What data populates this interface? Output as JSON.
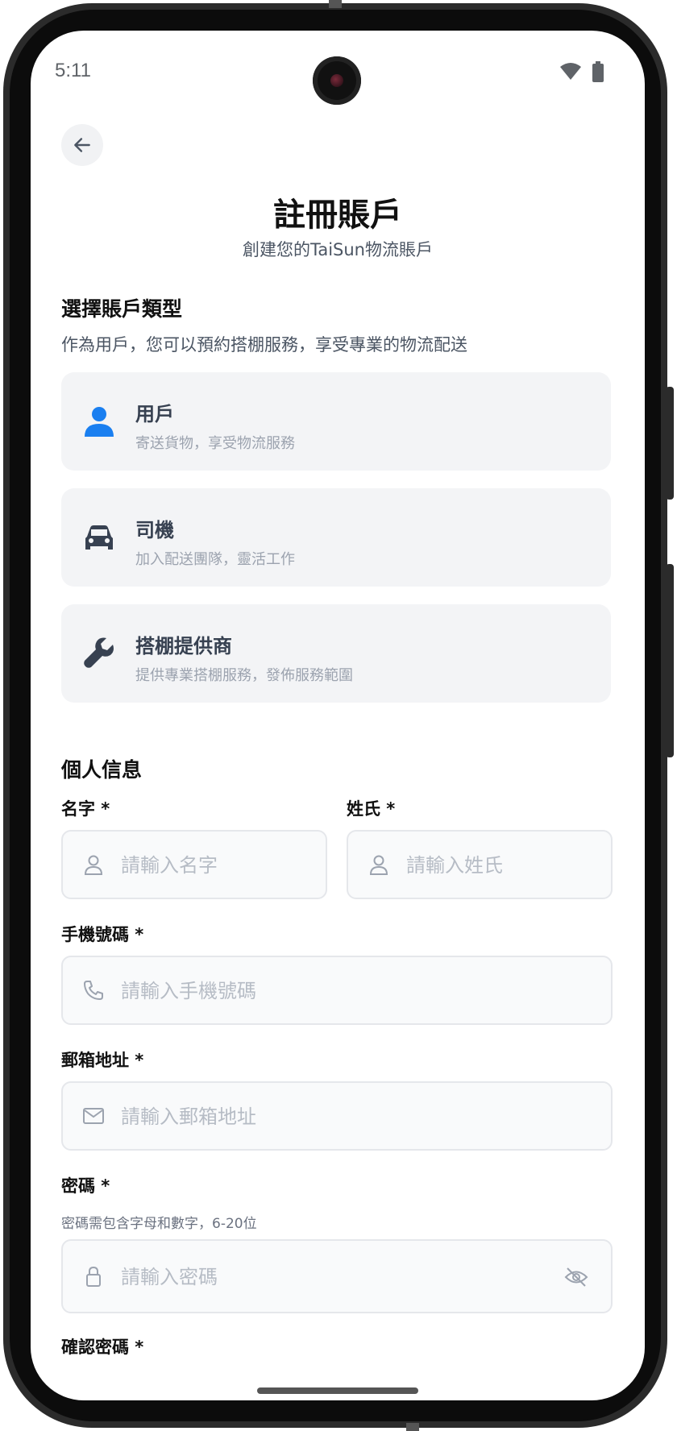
{
  "status_bar": {
    "time": "5:11"
  },
  "header": {
    "title": "註冊賬戶",
    "subtitle": "創建您的TaiSun物流賬戶"
  },
  "account_type": {
    "section_title": "選擇賬戶類型",
    "description": "作為用戶，您可以預約搭棚服務，享受專業的物流配送",
    "options": [
      {
        "label": "用戶",
        "description": "寄送貨物，享受物流服務",
        "icon": "person-icon",
        "selected": true
      },
      {
        "label": "司機",
        "description": "加入配送團隊，靈活工作",
        "icon": "car-icon",
        "selected": false
      },
      {
        "label": "搭棚提供商",
        "description": "提供專業搭棚服務，發佈服務範圍",
        "icon": "wrench-icon",
        "selected": false
      }
    ]
  },
  "personal_info": {
    "section_title": "個人信息",
    "first_name": {
      "label": "名字 *",
      "placeholder": "請輸入名字",
      "value": ""
    },
    "last_name": {
      "label": "姓氏 *",
      "placeholder": "請輸入姓氏",
      "value": ""
    },
    "phone": {
      "label": "手機號碼 *",
      "placeholder": "請輸入手機號碼",
      "value": ""
    },
    "email": {
      "label": "郵箱地址 *",
      "placeholder": "請輸入郵箱地址",
      "value": ""
    },
    "password": {
      "label": "密碼 *",
      "hint": "密碼需包含字母和數字，6-20位",
      "placeholder": "請輸入密碼",
      "value": ""
    },
    "confirm_password": {
      "label": "確認密碼 *"
    }
  },
  "colors": {
    "accent": "#1a7ff0",
    "card_bg": "#f3f4f6",
    "field_bg": "#f9fafb",
    "muted_text": "#9ca3af"
  }
}
